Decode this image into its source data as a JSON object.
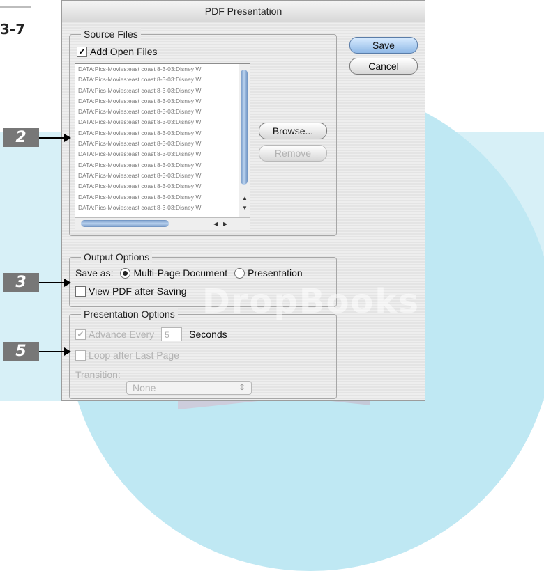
{
  "figure": {
    "label": "3-7",
    "callouts": [
      "2",
      "3",
      "5"
    ]
  },
  "watermark": {
    "text": "DropBooks"
  },
  "dialog": {
    "title": "PDF Presentation",
    "buttons": {
      "save": "Save",
      "cancel": "Cancel",
      "browse": "Browse...",
      "remove": "Remove"
    },
    "source_files": {
      "legend": "Source Files",
      "add_open_files": {
        "label": "Add Open Files",
        "checked": true
      },
      "items": [
        "DATA:Pics-Movies:east coast 8-3-03:Disney W",
        "DATA:Pics-Movies:east coast 8-3-03:Disney W",
        "DATA:Pics-Movies:east coast 8-3-03:Disney W",
        "DATA:Pics-Movies:east coast 8-3-03:Disney W",
        "DATA:Pics-Movies:east coast 8-3-03:Disney W",
        "DATA:Pics-Movies:east coast 8-3-03:Disney W",
        "DATA:Pics-Movies:east coast 8-3-03:Disney W",
        "DATA:Pics-Movies:east coast 8-3-03:Disney W",
        "DATA:Pics-Movies:east coast 8-3-03:Disney W",
        "DATA:Pics-Movies:east coast 8-3-03:Disney W",
        "DATA:Pics-Movies:east coast 8-3-03:Disney W",
        "DATA:Pics-Movies:east coast 8-3-03:Disney W",
        "DATA:Pics-Movies:east coast 8-3-03:Disney W",
        "DATA:Pics-Movies:east coast 8-3-03:Disney W"
      ]
    },
    "output_options": {
      "legend": "Output Options",
      "save_as_label": "Save as:",
      "options": [
        "Multi-Page Document",
        "Presentation"
      ],
      "selected": "Multi-Page Document",
      "view_pdf": {
        "label": "View PDF after Saving",
        "checked": false
      }
    },
    "presentation_options": {
      "legend": "Presentation Options",
      "advance_every": {
        "label": "Advance Every",
        "value": "5",
        "unit": "Seconds",
        "checked": true,
        "enabled": false
      },
      "loop": {
        "label": "Loop after Last Page",
        "checked": false,
        "enabled": false
      },
      "transition_label": "Transition:",
      "transition_value": "None"
    }
  }
}
